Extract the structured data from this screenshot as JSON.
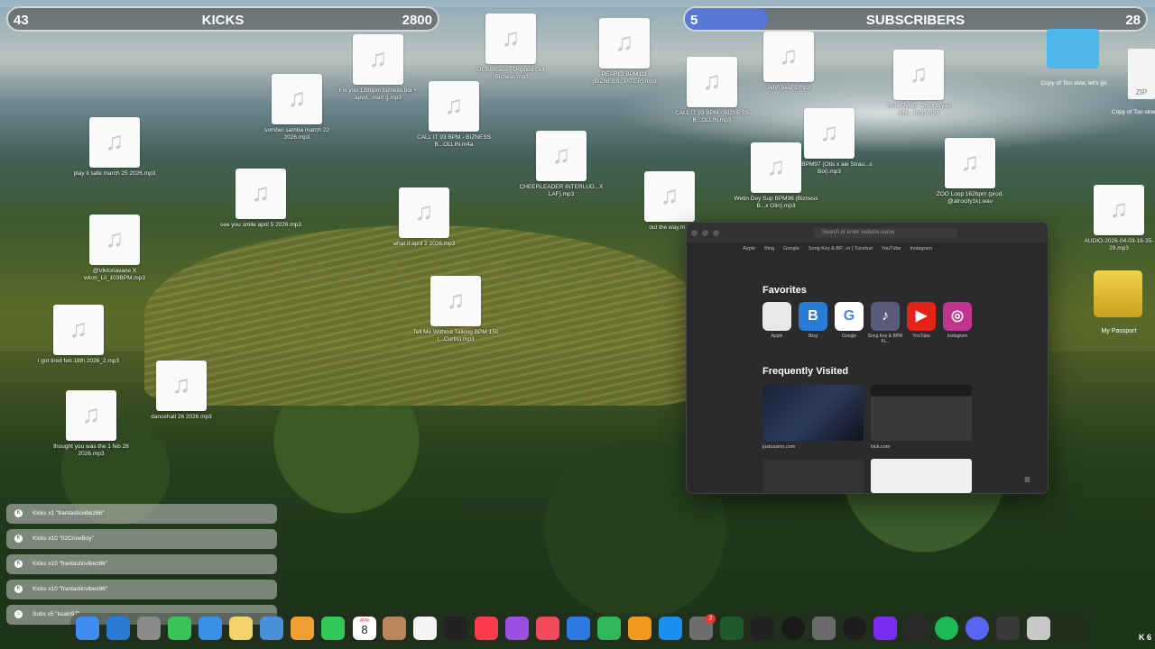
{
  "counters": {
    "kicks": {
      "left": "43",
      "label": "KICKS",
      "right": "2800"
    },
    "subs": {
      "left": "5",
      "label": "SUBSCRIBERS",
      "right": "28",
      "progress": 0.18
    }
  },
  "desktop_files": [
    {
      "label": "Fix you 128bpm bizness boi + apvd...matt g.mp3"
    },
    {
      "label": "Of Justcase - Dripped Out (Bizness.mp3"
    },
    {
      "label": "PEARL2 BPM111 (BIZNESS...PITER).mp3"
    },
    {
      "label": "somber samba march 22 2026.mp3"
    },
    {
      "label": "CALL IT 93 BPM - BIZNESS B...OLLIN.m4a"
    },
    {
      "label": "play it safe march 25 2026.mp3"
    },
    {
      "label": "CHEERLEADER INTERLUD...X LAF).mp3"
    },
    {
      "label": "see you smile april 5 2026.mp3"
    },
    {
      "label": "what if april 2 2026.mp3"
    },
    {
      "label": "@Viktoriavane X wlcm_Lil_103BPM.mp3"
    },
    {
      "label": "Tell Me Without Talking BPM 150 (...Curtis).mp3"
    },
    {
      "label": "i got tired feb 18th 2026_2.mp3"
    },
    {
      "label": "dancehall 26 2026.mp3"
    },
    {
      "label": "thought you was the 1 feb 28 2026.mp3"
    },
    {
      "label": "CALL IT 93 BPM - BIZNESS B...OLLIN.mp3"
    },
    {
      "label": "Jahh beat 1.mp3"
    },
    {
      "label": "2forwOyNE - 2fo x bryan tyty-...inor).mp3"
    },
    {
      "label": "Sapa BPM97 (Otis x aie Strau...s Boi).mp3"
    },
    {
      "label": "Wetin Dey Sup BPM96 (Bizness B...x Olin).mp3"
    },
    {
      "label": "out the way.m..."
    },
    {
      "label": "ZOO Loop 162bpm (prod. @atrocity1k).wav"
    },
    {
      "label": "AUDIO-2026-04-03-16-35-29.mp3"
    }
  ],
  "folder": {
    "label": "Copy of Too slow, let's go"
  },
  "zip": {
    "label": "Copy of Too slow, let's go.zip",
    "text": "ZIP"
  },
  "drive": {
    "label": "My Passport"
  },
  "safari": {
    "address_placeholder": "Search or enter website name",
    "bookmarks": [
      "Apple",
      "Bing",
      "Google",
      "Song Key & BP...er | Tunebat",
      "YouTube",
      "Instagram"
    ],
    "favorites_title": "Favorites",
    "favorites": [
      {
        "label": "Apple",
        "glyph": "",
        "color": "#e8e8e8"
      },
      {
        "label": "Bing",
        "glyph": "B",
        "color": "#2a7bd6"
      },
      {
        "label": "Google",
        "glyph": "G",
        "color": "#ffffff"
      },
      {
        "label": "Song Key & BPM Fi...",
        "glyph": "♪",
        "color": "#5a5a7a"
      },
      {
        "label": "YouTube",
        "glyph": "▶",
        "color": "#e62117"
      },
      {
        "label": "Instagram",
        "glyph": "◎",
        "color": "#c1358f"
      }
    ],
    "frequent_title": "Frequently Visited",
    "frequent": [
      {
        "label": "justcasino.com"
      },
      {
        "label": "kick.com"
      }
    ]
  },
  "notifications": [
    {
      "text": "Kicks x1 \"frantasticvibez86\""
    },
    {
      "text": "Kicks x10 \"02CrowBoy\""
    },
    {
      "text": "Kicks x10 \"frantasticvibez86\""
    },
    {
      "text": "Kicks x10 \"frantasticvibez86\""
    },
    {
      "text": "Subs x5 \"kcain97\""
    }
  ],
  "dock": {
    "calendar_month": "APR",
    "calendar_day": "8",
    "badge_count": "2",
    "apps": [
      "finder-icon",
      "safari-icon",
      "launchpad-icon",
      "messages-icon",
      "mail-icon",
      "notes-icon",
      "preview-icon",
      "photos-icon",
      "facetime-icon",
      "calendar-icon",
      "contacts-icon",
      "reminders-icon",
      "tv-icon",
      "music-icon",
      "podcasts-icon",
      "news-icon",
      "keynote-icon",
      "numbers-icon",
      "pages-icon",
      "app-store-icon",
      "system-settings-icon",
      "logic-icon",
      "ilok-icon",
      "circle-app-icon",
      "compressor-icon",
      "obs-icon",
      "audio-icon",
      "audio2-icon",
      "spotify-icon",
      "discord-icon",
      "activity-monitor-icon",
      "trash-icon"
    ]
  },
  "corner_text": "K 6"
}
